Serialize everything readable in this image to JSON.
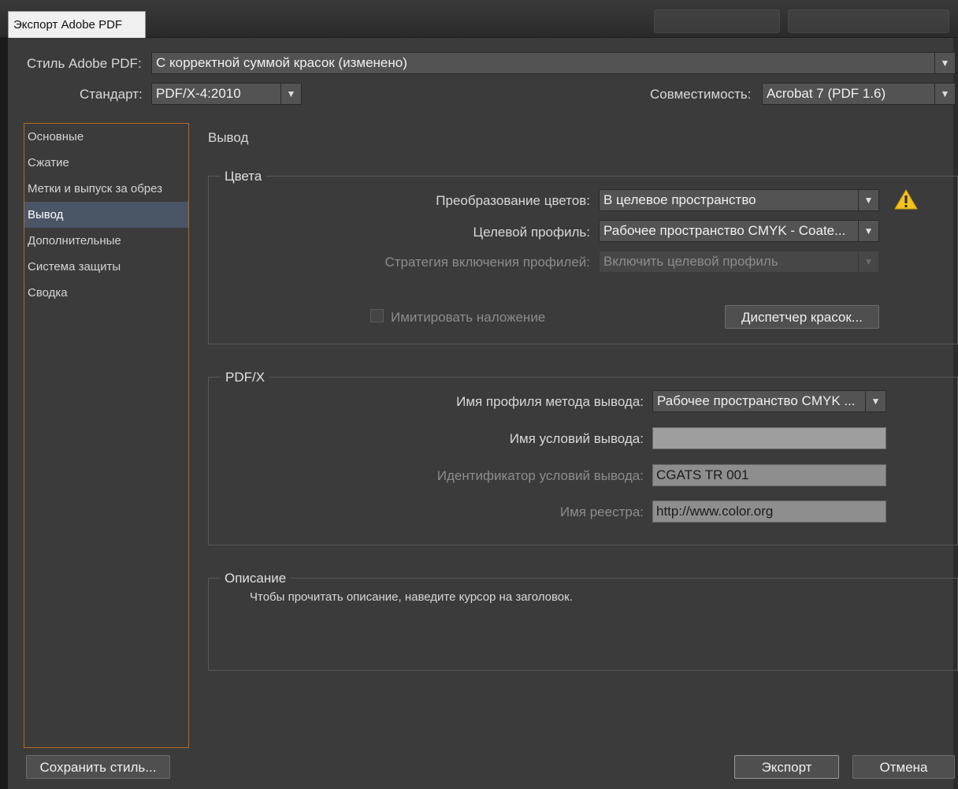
{
  "window": {
    "title": "Экспорт Adobe PDF"
  },
  "header": {
    "style_label": "Стиль Adobe PDF:",
    "style_value": "С корректной суммой красок (изменено)",
    "standard_label": "Стандарт:",
    "standard_value": "PDF/X-4:2010",
    "compat_label": "Совместимость:",
    "compat_value": "Acrobat 7 (PDF 1.6)"
  },
  "sidebar": {
    "items": [
      {
        "label": "Основные"
      },
      {
        "label": "Сжатие"
      },
      {
        "label": "Метки и выпуск за обрез"
      },
      {
        "label": "Вывод"
      },
      {
        "label": "Дополнительные"
      },
      {
        "label": "Система защиты"
      },
      {
        "label": "Сводка"
      }
    ],
    "active_index": 3
  },
  "main": {
    "section_title": "Вывод",
    "colors": {
      "group_title": "Цвета",
      "conversion_label": "Преобразование цветов:",
      "conversion_value": "В целевое пространство",
      "target_label": "Целевой профиль:",
      "target_value": "Рабочее пространство CMYK - Coate...",
      "strategy_label": "Стратегия включения профилей:",
      "strategy_value": "Включить целевой профиль",
      "simulate_label": "Имитировать наложение",
      "simulate_checked": false,
      "ink_manager_button": "Диспетчер красок..."
    },
    "pdfx": {
      "group_title": "PDF/X",
      "output_profile_label": "Имя профиля метода вывода:",
      "output_profile_value": "Рабочее пространство CMYK ...",
      "condition_name_label": "Имя условий вывода:",
      "condition_name_value": "",
      "condition_id_label": "Идентификатор условий вывода:",
      "condition_id_value": "CGATS TR 001",
      "registry_label": "Имя реестра:",
      "registry_value": "http://www.color.org"
    },
    "description": {
      "group_title": "Описание",
      "text": "Чтобы прочитать описание, наведите курсор на заголовок."
    }
  },
  "footer": {
    "save_style_button": "Сохранить стиль...",
    "export_button": "Экспорт",
    "cancel_button": "Отмена"
  },
  "colors": {
    "dialog_bg": "#3b3b3b",
    "sidebar_border": "#b86a22",
    "active_item_bg": "#4a5566",
    "warning": "#f2c31c"
  }
}
